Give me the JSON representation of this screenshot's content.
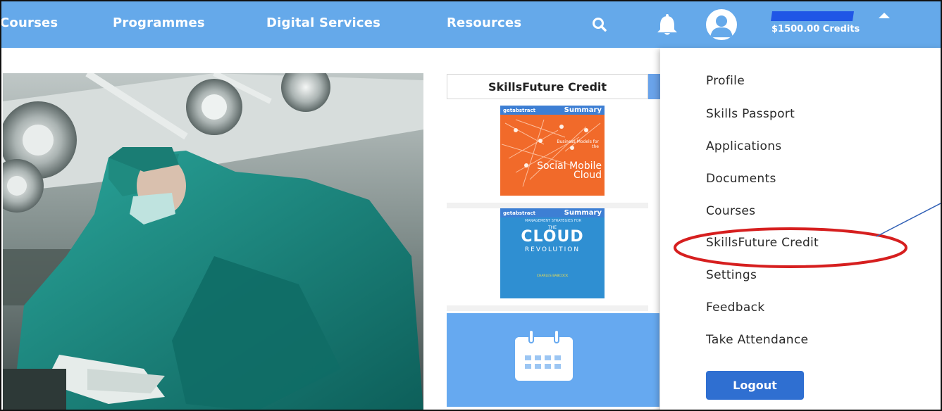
{
  "nav": {
    "items": [
      {
        "label": "Courses"
      },
      {
        "label": "Programmes"
      },
      {
        "label": "Digital Services"
      },
      {
        "label": "Resources"
      }
    ],
    "credits": "$1500.00 Credits"
  },
  "middle": {
    "tab_label": "SkillsFuture Credit",
    "book1": {
      "brand": "getabstract",
      "badge": "Summary",
      "subtitle": "Business Models for the",
      "title": "Social Mobile Cloud"
    },
    "book2": {
      "brand": "getabstract",
      "badge": "Summary",
      "kicker": "MANAGEMENT STRATEGIES FOR",
      "the": "THE",
      "title": "CLOUD",
      "subtitle": "REVOLUTION",
      "author": "CHARLES BABCOCK"
    }
  },
  "dropdown": {
    "items": [
      {
        "label": "Profile"
      },
      {
        "label": "Skills Passport"
      },
      {
        "label": "Applications"
      },
      {
        "label": "Documents"
      },
      {
        "label": "Courses"
      },
      {
        "label": "SkillsFuture Credit"
      },
      {
        "label": "Settings"
      },
      {
        "label": "Feedback"
      },
      {
        "label": "Take Attendance"
      }
    ],
    "logout_label": "Logout"
  },
  "colors": {
    "topbar": "#65a9ea",
    "accent": "#2f6fd1",
    "highlight_ellipse": "#d61f1f",
    "annotation_line": "#2f5fb5"
  },
  "icons": {
    "search": "search-icon",
    "bell": "bell-icon",
    "avatar": "user-avatar-icon",
    "caret": "caret-up-icon",
    "calendar": "calendar-icon"
  }
}
